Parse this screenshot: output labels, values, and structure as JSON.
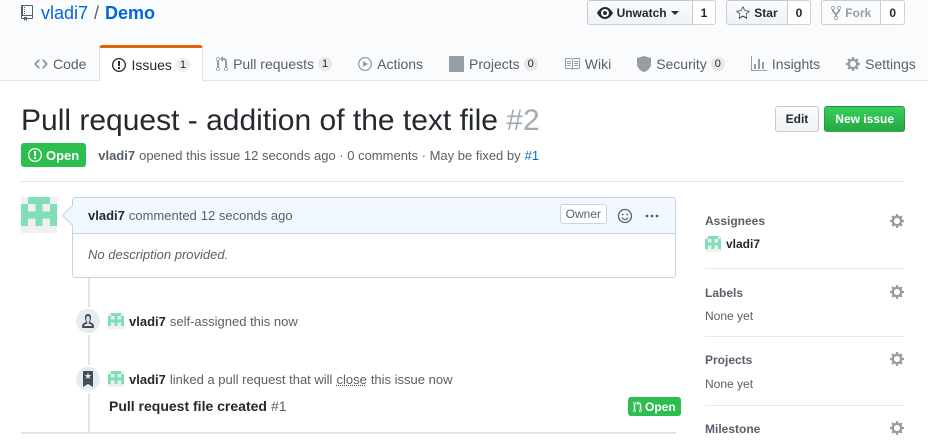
{
  "repo": {
    "owner": "vladi7",
    "separator": "/",
    "name": "Demo"
  },
  "actions": {
    "watch": {
      "label": "Unwatch",
      "count": "1"
    },
    "star": {
      "label": "Star",
      "count": "0"
    },
    "fork": {
      "label": "Fork",
      "count": "0"
    }
  },
  "tabs": [
    {
      "label": "Code",
      "icon": "code-icon"
    },
    {
      "label": "Issues",
      "icon": "issue-opened-icon",
      "counter": "1",
      "selected": true
    },
    {
      "label": "Pull requests",
      "icon": "git-pull-request-icon",
      "counter": "1"
    },
    {
      "label": "Actions",
      "icon": "play-icon"
    },
    {
      "label": "Projects",
      "icon": "project-icon",
      "counter": "0"
    },
    {
      "label": "Wiki",
      "icon": "book-icon"
    },
    {
      "label": "Security",
      "icon": "shield-icon",
      "counter": "0"
    },
    {
      "label": "Insights",
      "icon": "graph-icon"
    },
    {
      "label": "Settings",
      "icon": "gear-icon"
    }
  ],
  "issue": {
    "title": "Pull request - addition of the text file",
    "number": "#2",
    "edit_label": "Edit",
    "new_issue_label": "New issue",
    "state": "Open",
    "meta": {
      "author": "vladi7",
      "text": "opened this issue 12 seconds ago · 0 comments · May be fixed by",
      "fixed_by": "#1"
    }
  },
  "comment": {
    "author": "vladi7",
    "action": "commented",
    "time": "12 seconds ago",
    "owner_label": "Owner",
    "body": "No description provided."
  },
  "events": [
    {
      "author": "vladi7",
      "text": "self-assigned this now",
      "icon": "person-icon"
    },
    {
      "author": "vladi7",
      "text_before": "linked a pull request that will",
      "close_word": "close",
      "text_after": "this issue now",
      "icon": "bookmark-icon"
    }
  ],
  "linked_pr": {
    "title": "Pull request file created",
    "number": "#1",
    "state": "Open"
  },
  "sidebar": {
    "assignees": {
      "heading": "Assignees",
      "value": "vladi7"
    },
    "labels": {
      "heading": "Labels",
      "value": "None yet"
    },
    "projects": {
      "heading": "Projects",
      "value": "None yet"
    },
    "milestone": {
      "heading": "Milestone"
    }
  },
  "colors": {
    "link": "#0366d6",
    "open_green": "#2cbe4e",
    "new_issue_green": "#28a745",
    "tab_accent": "#e36209",
    "comment_header_bg": "#f1f8ff",
    "identicon": "#7fe0b7"
  }
}
